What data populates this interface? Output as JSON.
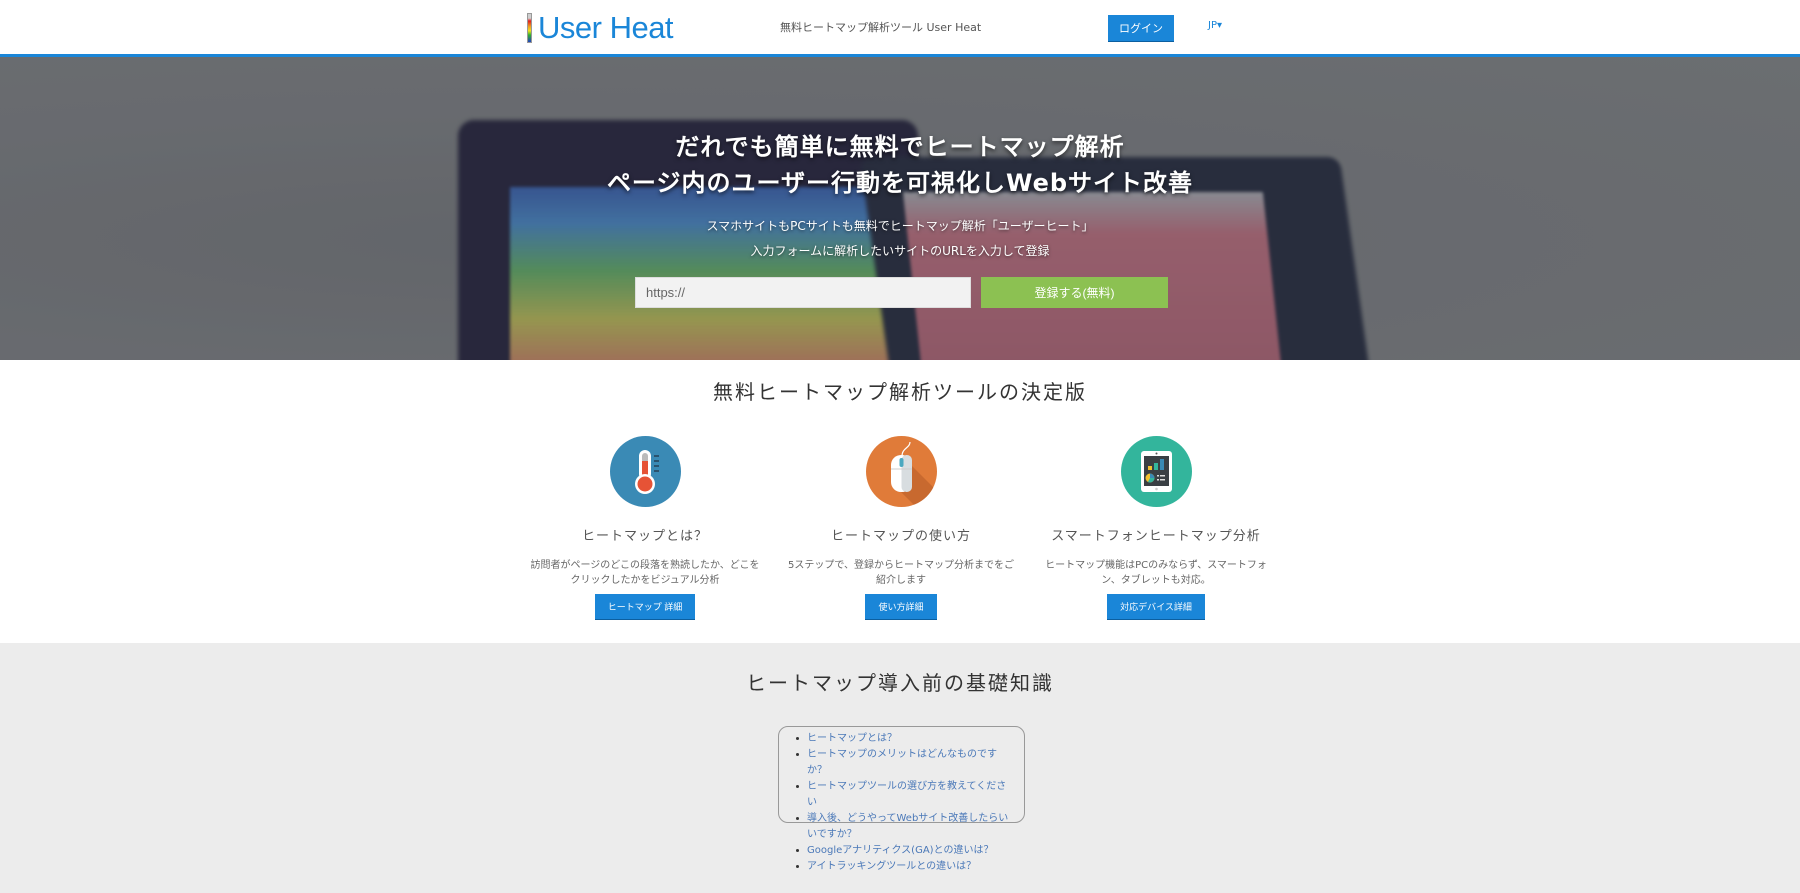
{
  "header": {
    "logo_text": "User Heat",
    "tagline": "無料ヒートマップ解析ツール User Heat",
    "login_label": "ログイン",
    "language": "JP▾",
    "accent_color": "#1a86d8"
  },
  "hero": {
    "title_line1": "だれでも簡単に無料でヒートマップ解析",
    "title_line2": "ページ内のユーザー行動を可視化しWebサイト改善",
    "sub_line1": "スマホサイトもPCサイトも無料でヒートマップ解析「ユーザーヒート」",
    "sub_line2": "入力フォームに解析したいサイトのURLを入力して登録",
    "url_input_value": "https://",
    "register_label": "登録する(無料)",
    "register_color": "#8cc152"
  },
  "features": {
    "title": "無料ヒートマップ解析ツールの決定版",
    "items": [
      {
        "icon": "thermometer-icon",
        "title": "ヒートマップとは？",
        "desc": "訪問者がページのどこの段落を熟読したか、どこをクリックしたかをビジュアル分析",
        "button": "ヒートマップ 詳細",
        "color": "#3a8ab5"
      },
      {
        "icon": "mouse-icon",
        "title": "ヒートマップの使い方",
        "desc": "5ステップで、登録からヒートマップ分析までをご紹介します",
        "button": "使い方詳細",
        "color": "#e07b39"
      },
      {
        "icon": "tablet-chart-icon",
        "title": "スマートフォンヒートマップ分析",
        "desc": "ヒートマップ機能はPCのみならず、スマートフォン、タブレットも対応。",
        "button": "対応デバイス詳細",
        "color": "#33b59c"
      }
    ]
  },
  "knowledge": {
    "title": "ヒートマップ導入前の基礎知識",
    "faq": [
      "ヒートマップとは？",
      "ヒートマップのメリットはどんなものですか？",
      "ヒートマップツールの選び方を教えてください",
      "導入後、どうやってWebサイト改善したらいいですか？",
      "Googleアナリティクス(GA)との違いは？",
      "アイトラッキングツールとの違いは？"
    ]
  }
}
